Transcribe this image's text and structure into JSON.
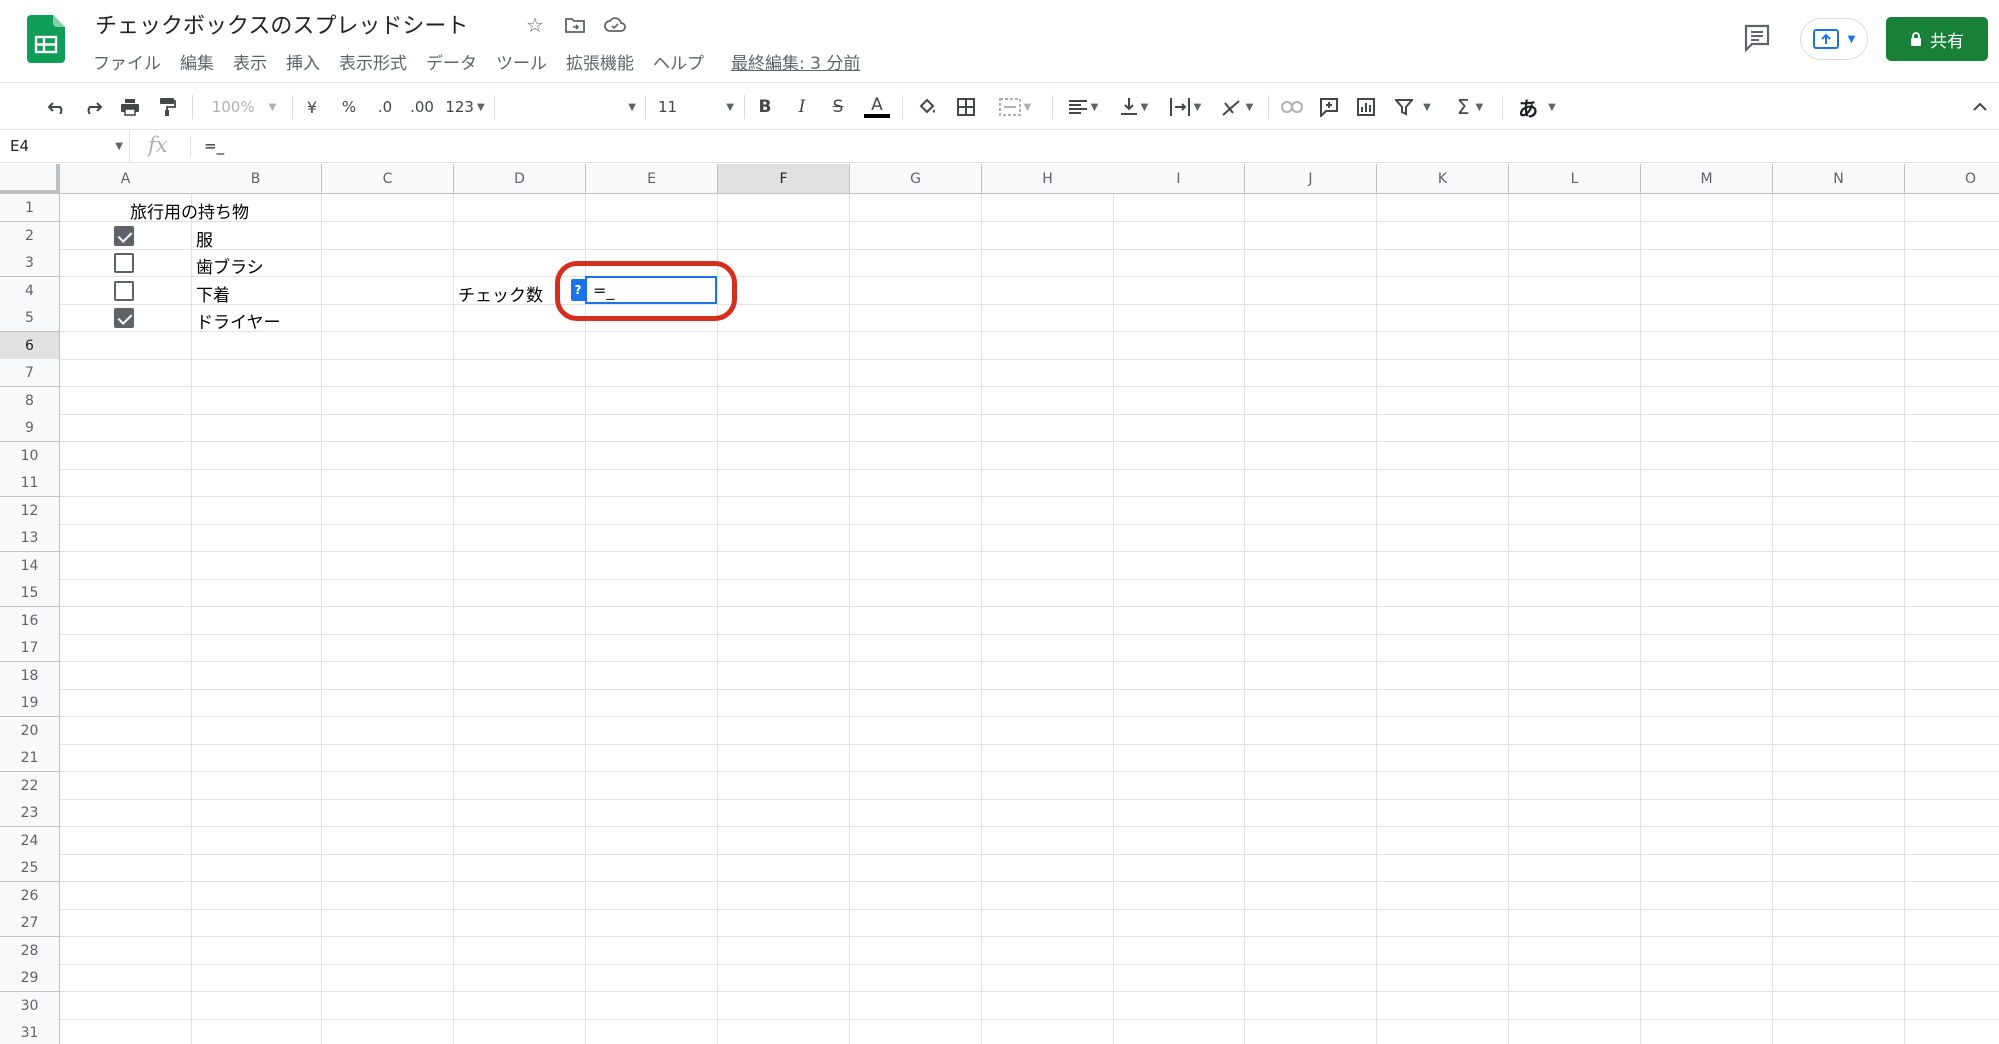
{
  "document": {
    "title": "チェックボックスのスプレッドシート",
    "menus": [
      "ファイル",
      "編集",
      "表示",
      "挿入",
      "表示形式",
      "データ",
      "ツール",
      "拡張機能",
      "ヘルプ"
    ],
    "last_edit": "最終編集: 3 分前"
  },
  "share": {
    "label": "共有"
  },
  "toolbar": {
    "zoom": "100%",
    "currency": "¥",
    "percent": "%",
    "decrease_decimals": ".0",
    "increase_decimals": ".00",
    "format_more": "123",
    "font_size": "11",
    "bold": "B",
    "italic": "I",
    "strike": "S",
    "text_color": "A",
    "functions": "Σ",
    "input_tools": "あ"
  },
  "formula_bar": {
    "cell_ref": "E4",
    "fx_label": "fx",
    "formula": "=_"
  },
  "columns": [
    "A",
    "B",
    "C",
    "D",
    "E",
    "F",
    "G",
    "H",
    "I",
    "J",
    "K",
    "L",
    "M",
    "N",
    "O"
  ],
  "selected_column": "F",
  "rows": [
    "1",
    "2",
    "3",
    "4",
    "5",
    "6",
    "7",
    "8",
    "9",
    "10",
    "11",
    "12",
    "13",
    "14",
    "15",
    "16",
    "17",
    "18",
    "19",
    "20",
    "21",
    "22",
    "23",
    "24",
    "25",
    "26",
    "27",
    "28",
    "29",
    "30",
    "31"
  ],
  "selected_row": "6",
  "cells": {
    "A1": "旅行用の持ち物",
    "B2": "服",
    "B3": "歯ブラシ",
    "B4": "下着",
    "B5": "ドライヤー",
    "D4": "チェック数"
  },
  "checkboxes": [
    {
      "cell": "A2",
      "checked": true
    },
    {
      "cell": "A3",
      "checked": false
    },
    {
      "cell": "A4",
      "checked": false
    },
    {
      "cell": "A5",
      "checked": true
    }
  ],
  "editor": {
    "cell": "E4",
    "value": "=_",
    "help_badge": "?"
  },
  "colors": {
    "share_green": "#188038",
    "selection_blue": "#1a73e8",
    "highlight_red": "#d62e1f",
    "sheets_green": "#0f9d58"
  }
}
